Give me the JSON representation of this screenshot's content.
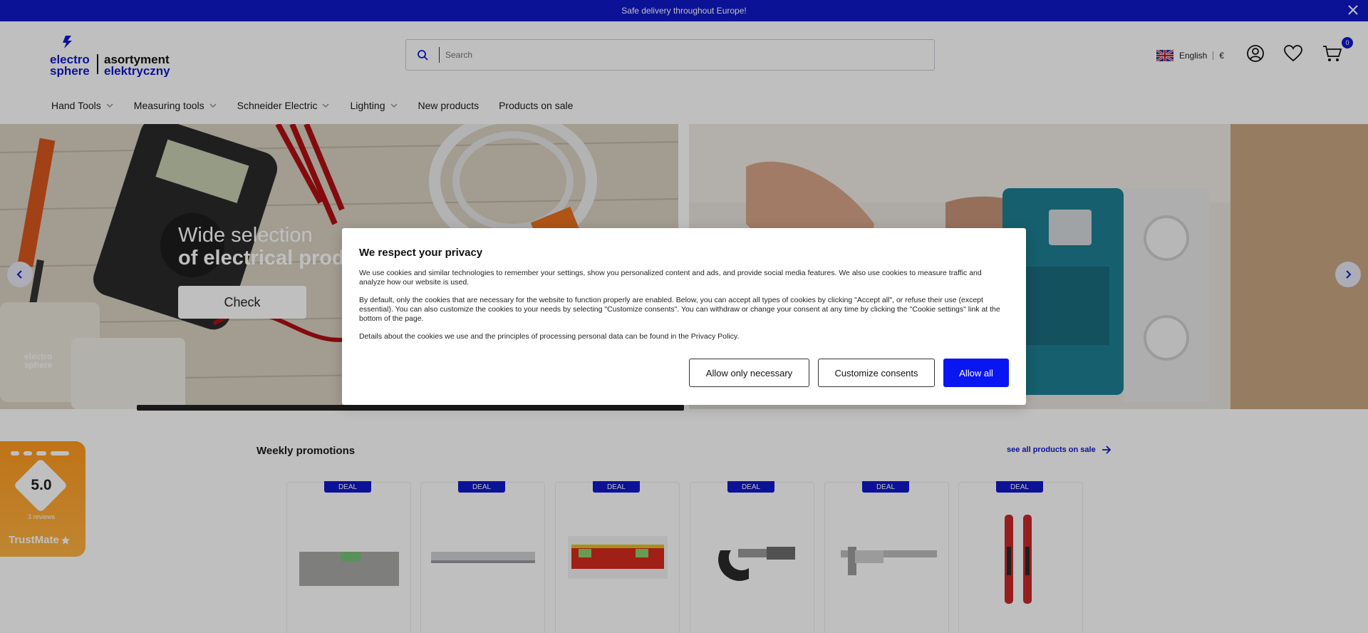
{
  "topbar": {
    "message": "Safe delivery throughout Europe!",
    "close_icon": "close-icon"
  },
  "header": {
    "logo": {
      "line1": "electro",
      "line2": "sphere",
      "tagline1": "asortyment",
      "tagline2": "elektryczny"
    },
    "search": {
      "placeholder": "Search"
    },
    "language": {
      "label": "English",
      "currency": "€"
    },
    "cart": {
      "count": "0"
    }
  },
  "nav": {
    "items": [
      {
        "label": "Hand Tools",
        "has_dropdown": true
      },
      {
        "label": "Measuring tools",
        "has_dropdown": true
      },
      {
        "label": "Schneider Electric",
        "has_dropdown": true
      },
      {
        "label": "Lighting",
        "has_dropdown": true
      },
      {
        "label": "New products",
        "has_dropdown": false
      },
      {
        "label": "Products on sale",
        "has_dropdown": false
      }
    ]
  },
  "hero": {
    "title_line1": "Wide selection",
    "title_line2": "of electrical prod",
    "button": "Check",
    "watermark1": "electro",
    "watermark2": "sphere"
  },
  "promos": {
    "title": "Weekly promotions",
    "link": "see all products on sale",
    "products": [
      {
        "badge": "DEAL",
        "image": "spirit-level"
      },
      {
        "badge": "DEAL",
        "image": "aluminium-level"
      },
      {
        "badge": "DEAL",
        "image": "red-level"
      },
      {
        "badge": "DEAL",
        "image": "micrometer"
      },
      {
        "badge": "DEAL",
        "image": "caliper"
      },
      {
        "badge": "DEAL",
        "image": "voltage-tester"
      }
    ]
  },
  "trustmate": {
    "score": "5.0",
    "reviews": "3 reviews",
    "brand": "TrustMate"
  },
  "cookie": {
    "title": "We respect your privacy",
    "p1": "We use cookies and similar technologies to remember your settings, show you personalized content and ads, and provide social media features. We also use cookies to measure traffic and analyze how our website is used.",
    "p2": "By default, only the cookies that are necessary for the website to function properly are enabled. Below, you can accept all types of cookies by clicking \"Accept all\", or refuse their use (except essential). You can also customize the cookies to your needs by selecting \"Customize consents\". You can withdraw or change your consent at any time by clicking the \"Cookie settings\" link at the bottom of the page.",
    "p3": "Details about the cookies we use and the principles of processing personal data can be found in the Privacy Policy.",
    "btn_necessary": "Allow only necessary",
    "btn_customize": "Customize consents",
    "btn_all": "Allow all"
  },
  "colors": {
    "brand_blue": "#1019c8",
    "primary_button": "#0a16f2",
    "trustmate_orange": "#ff9a1f"
  }
}
